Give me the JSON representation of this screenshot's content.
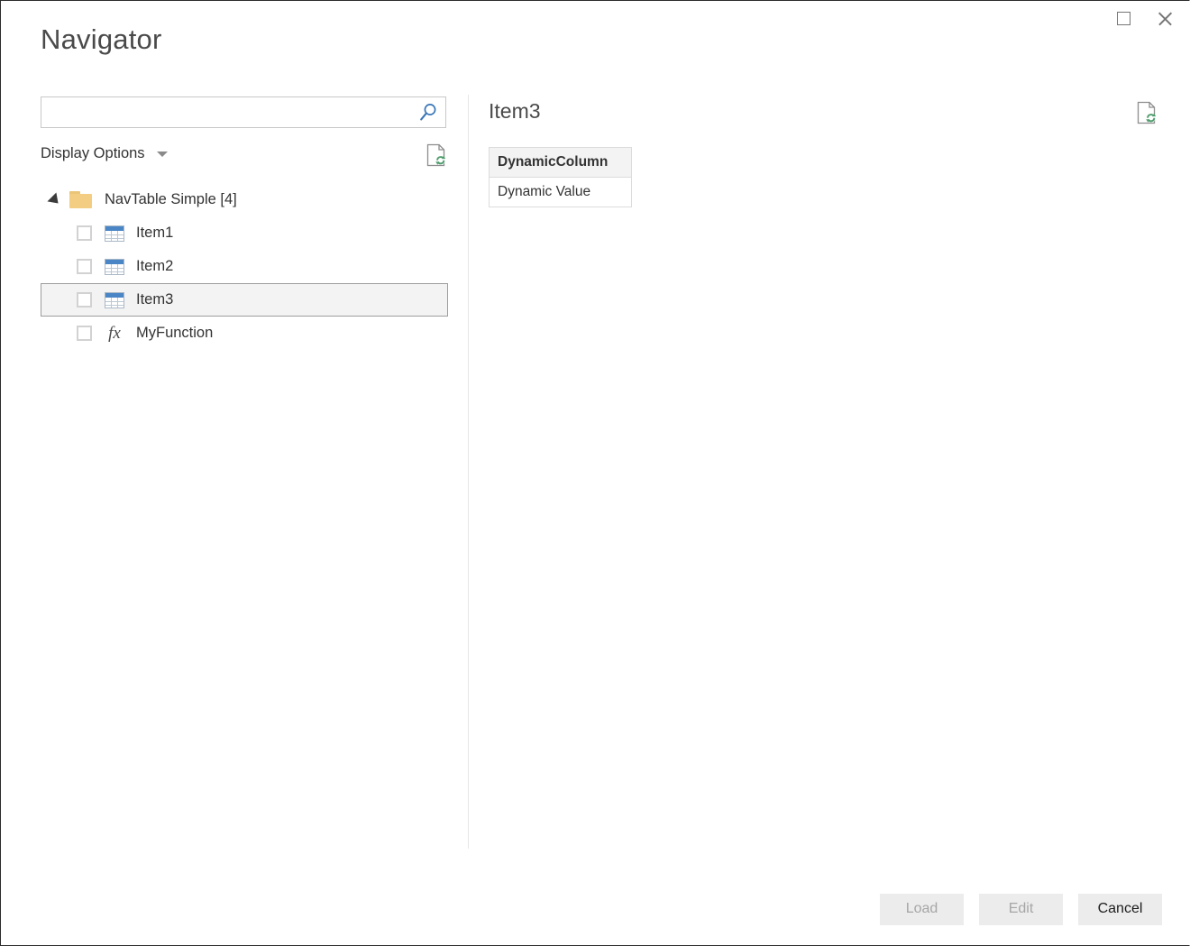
{
  "window": {
    "title": "Navigator",
    "controls": [
      {
        "name": "maximize-button",
        "label": "Maximize"
      },
      {
        "name": "close-button",
        "label": "Close"
      }
    ]
  },
  "search": {
    "value": "",
    "placeholder": "",
    "icon": "search-icon"
  },
  "display_options": {
    "label": "Display Options",
    "caret_icon": "chevron-down-icon",
    "refresh_icon": "refresh-document-icon"
  },
  "tree": {
    "root": {
      "label": "NavTable Simple [4]",
      "expanded": true,
      "icon": "folder-icon"
    },
    "items": [
      {
        "label": "Item1",
        "icon": "table-icon",
        "checked": false,
        "selected": false
      },
      {
        "label": "Item2",
        "icon": "table-icon",
        "checked": false,
        "selected": false
      },
      {
        "label": "Item3",
        "icon": "table-icon",
        "checked": false,
        "selected": true
      },
      {
        "label": "MyFunction",
        "icon": "function-fx-icon",
        "checked": false,
        "selected": false
      }
    ]
  },
  "preview": {
    "title": "Item3",
    "refresh_icon": "refresh-document-icon",
    "table": {
      "columns": [
        "DynamicColumn"
      ],
      "rows": [
        [
          "Dynamic Value"
        ]
      ]
    }
  },
  "footer": {
    "buttons": [
      {
        "label": "Load",
        "enabled": false
      },
      {
        "label": "Edit",
        "enabled": false
      },
      {
        "label": "Cancel",
        "enabled": true
      }
    ]
  },
  "colors": {
    "accent_blue": "#3a76b8",
    "table_icon_header": "#4a86c5",
    "folder": "#f3cd81",
    "refresh_green": "#4f9d6e",
    "selection_fill": "#f3f3f3",
    "selection_border": "#9d9d9d",
    "text": "#333333",
    "disabled_text": "#a6a6a6"
  }
}
